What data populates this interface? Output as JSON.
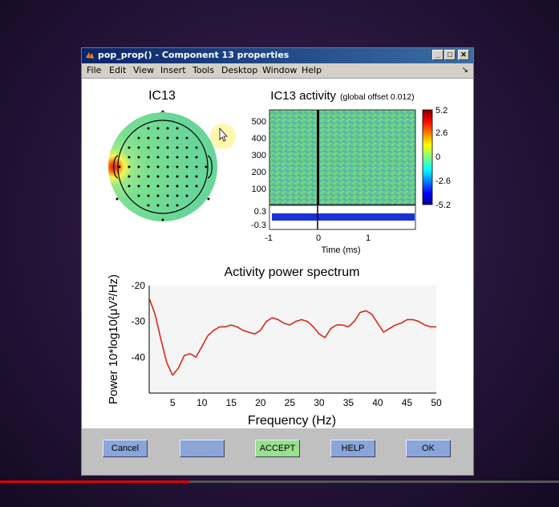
{
  "window": {
    "title": "pop_prop() - Component 13 properties"
  },
  "menu": [
    "File",
    "Edit",
    "View",
    "Insert",
    "Tools",
    "Desktop",
    "Window",
    "Help"
  ],
  "topo": {
    "title": "IC13"
  },
  "activity": {
    "title": "IC13 activity",
    "subtitle": "(global offset 0.012)",
    "y_ticks": [
      "500",
      "400",
      "300",
      "200",
      "100"
    ],
    "erp_ticks": [
      "0.3",
      "-0.3"
    ],
    "x_ticks": [
      "-1",
      "0",
      "1"
    ],
    "xlabel": "Time (ms)",
    "colorbar_ticks": [
      "5.2",
      "2.6",
      "0",
      "-2.6",
      "-5.2"
    ]
  },
  "spectrum": {
    "title": "Activity power spectrum",
    "xlabel": "Frequency (Hz)",
    "ylabel": "Power 10*log10(μV²/Hz)"
  },
  "chart_data": {
    "type": "line",
    "title": "Activity power spectrum",
    "xlabel": "Frequency (Hz)",
    "ylabel": "Power 10*log10(μV²/Hz)",
    "xlim": [
      1,
      50
    ],
    "ylim": [
      -50,
      -20
    ],
    "xticks": [
      5,
      10,
      15,
      20,
      25,
      30,
      35,
      40,
      45,
      50
    ],
    "yticks": [
      -20,
      -30,
      -40
    ],
    "series_color": "#d62a1a",
    "x": [
      1,
      2,
      3,
      4,
      5,
      6,
      7,
      8,
      9,
      10,
      11,
      12,
      13,
      14,
      15,
      16,
      17,
      18,
      19,
      20,
      21,
      22,
      23,
      24,
      25,
      26,
      27,
      28,
      29,
      30,
      31,
      32,
      33,
      34,
      35,
      36,
      37,
      38,
      39,
      40,
      41,
      42,
      43,
      44,
      45,
      46,
      47,
      48,
      49,
      50
    ],
    "y": [
      -23.5,
      -28,
      -35,
      -41.5,
      -45,
      -43,
      -39.5,
      -39,
      -40,
      -37,
      -34,
      -32.5,
      -31.5,
      -31.5,
      -31,
      -31.5,
      -32.5,
      -33,
      -33.5,
      -32.5,
      -30,
      -29,
      -29.5,
      -30.5,
      -31,
      -30,
      -29.5,
      -30,
      -31.5,
      -33.5,
      -34.5,
      -32,
      -31,
      -31,
      -31.5,
      -30,
      -27.5,
      -27,
      -28,
      -30.5,
      -33,
      -32,
      -31,
      -30.5,
      -29.5,
      -29.5,
      -30,
      -31,
      -31.5,
      -31.5
    ]
  },
  "buttons": {
    "cancel": "Cancel",
    "values": "Values",
    "accept": "ACCEPT",
    "help": "HELP",
    "ok": "OK"
  },
  "colors": {
    "button": "#8aa5d9",
    "accept": "#98e08e",
    "values_text": "#9aa6c4"
  },
  "video": {
    "progress": 0.34
  }
}
